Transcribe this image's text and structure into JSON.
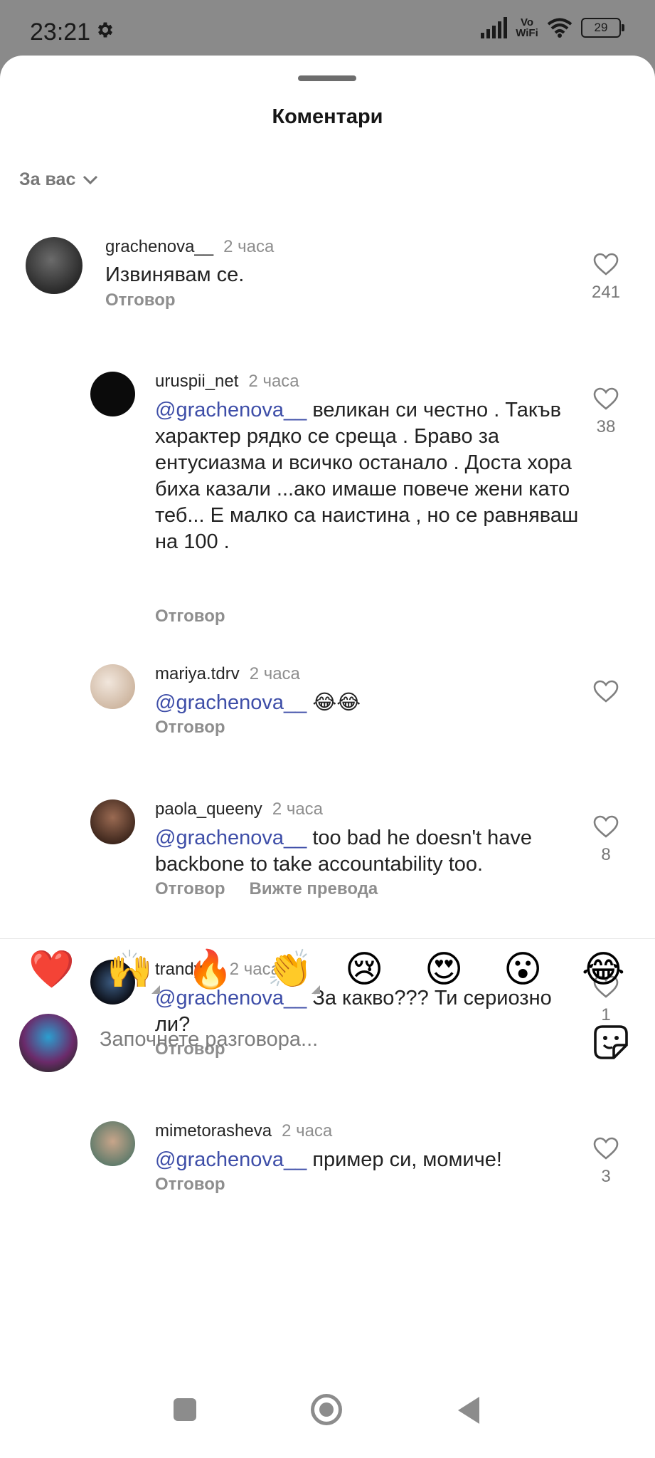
{
  "status_bar": {
    "time": "23:21",
    "network_label": "Vo WiFi",
    "battery": "29"
  },
  "sheet": {
    "title": "Коментари",
    "sort_label": "За вас"
  },
  "comments": [
    {
      "username": "grachenova__",
      "time": "2 часа",
      "mention": "",
      "text": "Извинявам се.",
      "reply_label": "Отговор",
      "translate_label": "",
      "likes": "241"
    },
    {
      "username": "uruspii_net",
      "time": "2 часа",
      "mention": "@grachenova__",
      "text": " великан си честно . Такъв характер рядко се среща . Браво за ентусиазма и всичко останало . Доста хора биха казали ...ако имаше повече жени като теб... Е малко са наистина , но се равняваш на 100 .",
      "reply_label": "Отговор",
      "translate_label": "",
      "likes": "38"
    },
    {
      "username": "mariya.tdrv",
      "time": "2 часа",
      "mention": "@grachenova__",
      "text": " 😂😂",
      "reply_label": "Отговор",
      "translate_label": "",
      "likes": ""
    },
    {
      "username": "paola_queeny",
      "time": "2 часа",
      "mention": "@grachenova__",
      "text": " too bad he doesn't have backbone to take accountability too.",
      "reply_label": "Отговор",
      "translate_label": "Вижте превода",
      "likes": "8"
    },
    {
      "username": "trandyil1",
      "time": "2 часа",
      "mention": "@grachenova__",
      "text": " За какво??? Ти сериозно ли?",
      "reply_label": "Отговор",
      "translate_label": "",
      "likes": "1"
    },
    {
      "username": "mimetorasheva",
      "time": "2 часа",
      "mention": "@grachenova__",
      "text": " пример си, момиче!",
      "reply_label": "Отговор",
      "translate_label": "",
      "likes": "3"
    }
  ],
  "reactions": [
    "❤️",
    "🙌",
    "🔥",
    "👏",
    "😢",
    "😍",
    "😮",
    "😂"
  ],
  "composer": {
    "placeholder": "Започнете разговора..."
  }
}
